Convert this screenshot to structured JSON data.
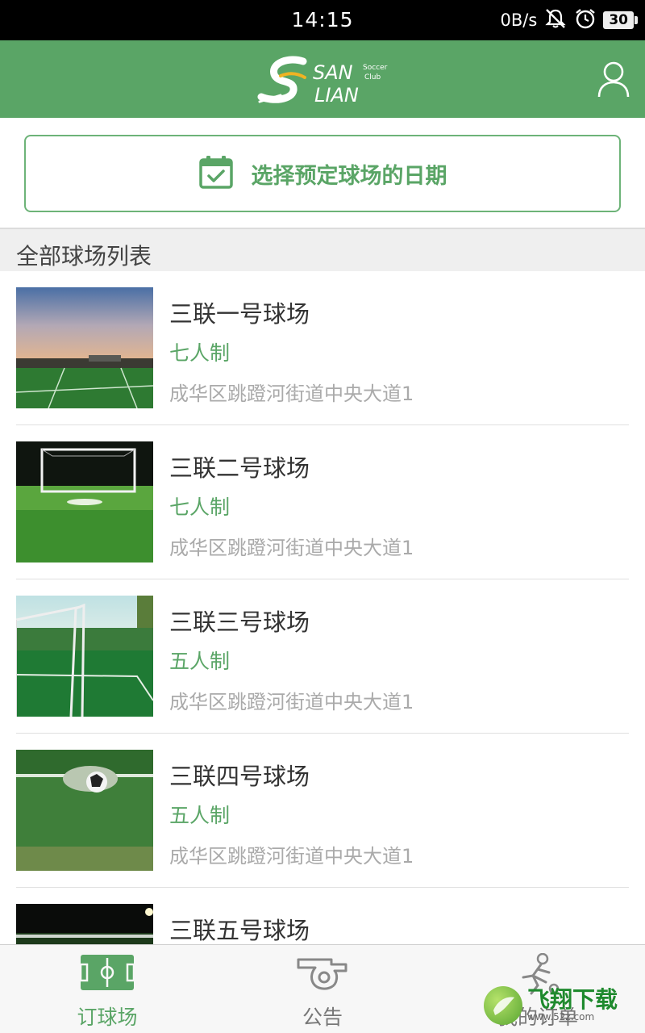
{
  "status_bar": {
    "time": "14:15",
    "network_speed": "0B/s",
    "mute_icon": "bell-mute-icon",
    "alarm_icon": "alarm-icon",
    "battery": "30"
  },
  "app_bar": {
    "logo_text_1": "SAN",
    "logo_text_2": "LIAN",
    "logo_small_1": "Soccer",
    "logo_small_2": "Club",
    "user_icon": "user-icon"
  },
  "date_picker": {
    "icon": "calendar-check-icon",
    "label": "选择预定球场的日期"
  },
  "section": {
    "title": "全部球场列表"
  },
  "fields": [
    {
      "name": "三联一号球场",
      "type": "七人制",
      "address": "成华区跳蹬河街道中央大道1"
    },
    {
      "name": "三联二号球场",
      "type": "七人制",
      "address": "成华区跳蹬河街道中央大道1"
    },
    {
      "name": "三联三号球场",
      "type": "五人制",
      "address": "成华区跳蹬河街道中央大道1"
    },
    {
      "name": "三联四号球场",
      "type": "五人制",
      "address": "成华区跳蹬河街道中央大道1"
    },
    {
      "name": "三联五号球场",
      "type": "",
      "address": ""
    }
  ],
  "tabs": [
    {
      "label": "订球场",
      "icon": "soccer-field-icon",
      "active": true
    },
    {
      "label": "公告",
      "icon": "whistle-icon",
      "active": false
    },
    {
      "label": "我的订单",
      "icon": "player-kick-icon",
      "active": false
    }
  ],
  "watermark": {
    "text": "飞翔下载",
    "url": "www.52z.com"
  },
  "colors": {
    "brand_green": "#5aa566",
    "status_bar": "#000000"
  }
}
